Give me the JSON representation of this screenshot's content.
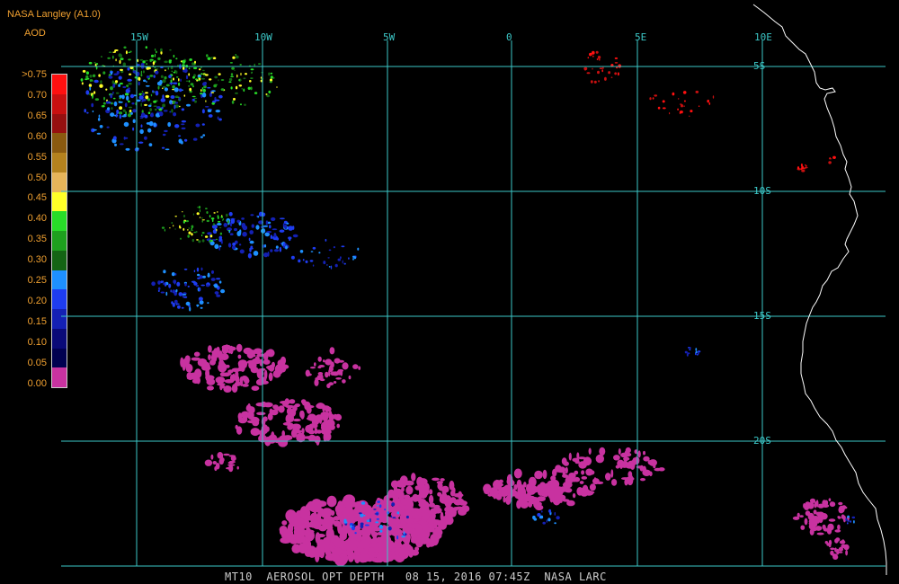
{
  "header": {
    "title": "NASA Langley (A1.0)",
    "variable": "AOD"
  },
  "legend": {
    "labels": [
      ">0.75",
      "0.70",
      "0.65",
      "0.60",
      "0.55",
      "0.50",
      "0.45",
      "0.40",
      "0.35",
      "0.30",
      "0.25",
      "0.20",
      "0.15",
      "0.10",
      "0.05",
      "0.00"
    ],
    "colors": [
      "#ff1010",
      "#c81010",
      "#961010",
      "#8a5a10",
      "#b4821e",
      "#e6b45a",
      "#ffff28",
      "#28dc28",
      "#1ea01e",
      "#146414",
      "#1e90ff",
      "#1e3cf0",
      "#1420b4",
      "#0a0a78",
      "#000050",
      "#c832a0"
    ]
  },
  "grid": {
    "color": "#3cc8c8",
    "lon_labels": [
      "15W",
      "10W",
      "5W",
      "0",
      "5E",
      "10E"
    ],
    "lat_labels": [
      "5S",
      "10S",
      "15S",
      "20S"
    ]
  },
  "coastline": {
    "color": "#ffffff"
  },
  "footer": {
    "text": "MT10  AEROSOL OPT DEPTH   08 15, 2016 07:45Z  NASA LARC"
  }
}
